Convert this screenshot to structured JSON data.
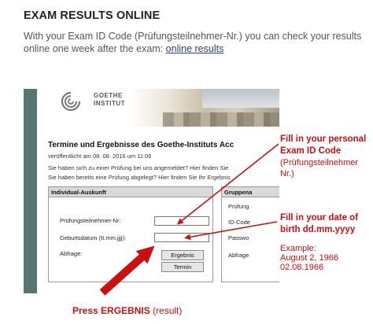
{
  "header": {
    "title": "EXAM RESULTS ONLINE",
    "intro_text": "With your Exam ID Code (Prüfungsteilnehmer-Nr.) you can check your results online one week after the exam: ",
    "intro_link": "online results"
  },
  "screenshot": {
    "logo_line1": "GOETHE",
    "logo_line2": "INSTITUT",
    "page_title": "Termine und Ergebnisse des Goethe-Instituts Acc",
    "published": "veröffentlicht am 08. 08. 2016 um 11:06",
    "line1": "Sie haben sich zu einer Prüfung bei uns angemeldet? Hier finden Sie",
    "line2": "Sie haben bereits eine Prüfung abgelegt? Hier finden Sie Ihr Ergebnis",
    "left_panel": {
      "header": "Individual-Auskunft",
      "exam_id_label": "Prüfungsteilnehmer-Nr:",
      "dob_label": "Geburtsdatum (tt.mm.jjjj):",
      "query_label": "Abfrage:",
      "ergebnis_button": "Ergebnis",
      "termin_button": "Termin"
    },
    "right_panel": {
      "header": "Gruppena",
      "l1": "Prüfung",
      "l2": "ID-Code",
      "l3": "Passwo",
      "l4": "Abfrage"
    }
  },
  "annotations": {
    "note1_bold": "Fill in your personal Exam ID Code",
    "note1_sub": "(Prüfungsteilnehmer Nr.)",
    "note2_bold": "Fill in your date of birth dd.mm.yyyy",
    "note2_sub_l1": "Example:",
    "note2_sub_l2": "August 2, 1966",
    "note2_sub_l3": "02.08.1966",
    "press_bold": "Press ERGEBNIS",
    "press_rest": " (result)"
  },
  "colors": {
    "annotation_red": "#cc1010",
    "sidebar_teal": "#587575",
    "link_blue": "#2a3f8f"
  }
}
